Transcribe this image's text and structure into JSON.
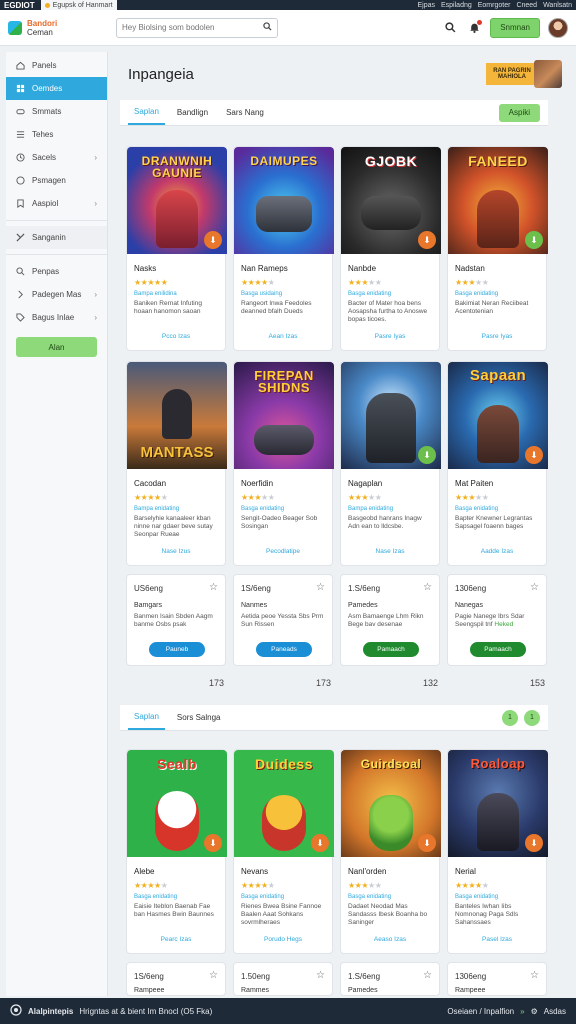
{
  "os_bar": {
    "app": "EGDIOT",
    "tab1": "Egupsk of Hanmart",
    "items": [
      "Ejpas",
      "Espiladng",
      "Eomrgoter",
      "Cneed",
      "Wanlsatn"
    ]
  },
  "header": {
    "logo_line1": "Bandori",
    "logo_line2": "Ceman",
    "search_placeholder": "Hey Biolsing som bodolen",
    "signin_label": "Snmnan"
  },
  "sidebar": {
    "items": [
      {
        "label": "Panels",
        "icon": "home-icon",
        "active": false,
        "chevron": false
      },
      {
        "label": "Oemdes",
        "icon": "grid-icon",
        "active": true,
        "chevron": false
      },
      {
        "label": "Smmats",
        "icon": "gamepad-icon",
        "active": false,
        "chevron": false
      },
      {
        "label": "Tehes",
        "icon": "list-icon",
        "active": false,
        "chevron": false
      },
      {
        "label": "Sacels",
        "icon": "clock-icon",
        "active": false,
        "chevron": true
      },
      {
        "label": "Psmagen",
        "icon": "circle-icon",
        "active": false,
        "chevron": false
      },
      {
        "label": "Aaspiol",
        "icon": "bookmark-icon",
        "active": false,
        "chevron": true
      }
    ],
    "items2": [
      {
        "label": "Sanganin",
        "icon": "tools-icon",
        "chevron": false
      }
    ],
    "items3": [
      {
        "label": "Penpas",
        "icon": "search-icon",
        "chevron": false
      },
      {
        "label": "Padegen Mas",
        "icon": "chevron-right-icon",
        "chevron": true
      },
      {
        "label": "Bagus Inlae",
        "icon": "tag-icon",
        "chevron": true
      }
    ],
    "cta_label": "Alan"
  },
  "main": {
    "title": "Inpangeia",
    "promo_text": "RAN PAGRIN MAHIOLA",
    "tabs1": [
      "Saplan",
      "Bandlign",
      "Sars Nang"
    ],
    "tabs1_action": "Aspiki",
    "row1": [
      {
        "art": "DRANWNIH GAUNIE",
        "name": "Nasks",
        "stars": 5,
        "tag": "Bampa enilidina",
        "desc": "Baniken Rernat Infuting hoaan hanomon saoan",
        "link": "Pcco Izas",
        "corner": "orange"
      },
      {
        "art": "DAIMUPES",
        "name": "Nan Rameps",
        "stars": 4,
        "tag": "Basga usidaing",
        "desc": "Rangeort lnwa Feedoles deanned bfalh Dueds",
        "link": "Aean Izas",
        "corner": "orange"
      },
      {
        "art": "GJOBK",
        "name": "Nanbde",
        "stars": 3,
        "tag": "Basga enidating",
        "desc": "Bacter of Mater hoa bens Aosapsha furtha to Anoswe bopas ticoes.",
        "link": "Pasre Iyas",
        "corner": "orange"
      },
      {
        "art": "FANEED",
        "name": "Nadstan",
        "stars": 3,
        "tag": "Basga enidating",
        "desc": "Bakimiat Neran Reciibeat Acentotenian",
        "link": "Pasre Iyas",
        "corner": "green"
      }
    ],
    "row2": [
      {
        "art": "MANTASS",
        "name": "Cacodan",
        "stars": 4,
        "tag": "Bampa enidating",
        "desc": "Barselyhie kanaaleer kban ninne nar gdaer beve sutay Seonpar Rueae",
        "link": "Nase Izus",
        "corner": ""
      },
      {
        "art": "FIREPAN SHIDNS",
        "name": "Noerfidin",
        "stars": 3,
        "tag": "Basga enidating",
        "desc": "Sengit-Oadeo Beager Sob Sosingan",
        "link": "Pecodlatipe",
        "corner": ""
      },
      {
        "art": "",
        "name": "Nagaplan",
        "stars": 3,
        "tag": "Bampa enidating",
        "desc": "Basgeobd hanrans Inagw Adn ean to lldcsbe.",
        "link": "Nase Izas",
        "corner": "green"
      },
      {
        "art": "Sapaan",
        "name": "Mat Paiten",
        "stars": 3,
        "tag": "Basga enidating",
        "desc": "Bapter Knewner Legrantas Sapsagel foaenn bages",
        "link": "Aadde Izas",
        "corner": "orange"
      }
    ],
    "row3": [
      {
        "price": "US6eng",
        "title": "Bamgars",
        "desc": "Banmen Isain Sbden Aagm banme Osbs psak",
        "hl": "",
        "btn": "Pauneb",
        "btn_color": "blue"
      },
      {
        "price": "1S/6eng",
        "title": "Nanmes",
        "desc": "Aetida peoe Yessta Sbs Prm Sun Rissen",
        "hl": "",
        "btn": "Paneads",
        "btn_color": "blue"
      },
      {
        "price": "1.S/6eng",
        "title": "Pamedes",
        "desc": "Asm Bamaenge Lhm Rikn Bege bav desenae",
        "hl": "",
        "btn": "Pamaach",
        "btn_color": "green"
      },
      {
        "price": "1306eng",
        "title": "Nanegas",
        "desc": "Pagie Nanege Ibrs Sdar Seengspil tnf ",
        "hl": "Heked",
        "btn": "Pamaach",
        "btn_color": "green"
      }
    ],
    "counts": [
      "173",
      "173",
      "132",
      "153"
    ],
    "tabs2": [
      "Saplan",
      "Sors Salnga"
    ],
    "tabs2_buttons": [
      "1",
      "1"
    ],
    "row4": [
      {
        "art": "Sealb",
        "name": "Alebe",
        "stars": 4,
        "tag": "Basga enidating",
        "desc": "Eaisie Iteblon Baenab Fae ban Hasmes Bwin Baunnes",
        "link": "Pearc Izas",
        "corner": "orange"
      },
      {
        "art": "Duidess",
        "name": "Nevans",
        "stars": 4,
        "tag": "Basga enidating",
        "desc": "Rienes Bwea Bsine Fannoe Baalen Aaat Sohkans sovrmlheraes",
        "link": "Porudo Hegs",
        "corner": "orange"
      },
      {
        "art": "Guirdsoal",
        "name": "Nanl'orden",
        "stars": 3,
        "tag": "Basga enidating",
        "desc": "Dadaet Neodad Mas Sandasss Ibesk Boanha bo Saninger",
        "link": "Aeaso Izas",
        "corner": "orange"
      },
      {
        "art": "Roaloap",
        "name": "Nerial",
        "stars": 4,
        "tag": "Basga enidating",
        "desc": "Banteles Iwhan Iibs Nomnonag Paga Sdls Sahanssaes",
        "link": "Pasel Izas",
        "corner": "orange"
      }
    ],
    "row5": [
      {
        "price": "1S/6eng",
        "title": "Rampeee"
      },
      {
        "price": "1.50eng",
        "title": "Rammes"
      },
      {
        "price": "1.S/6eng",
        "title": "Pamedes"
      },
      {
        "price": "1306eng",
        "title": "Rampeee"
      }
    ]
  },
  "bottom_bar": {
    "left": "Alalpintepis",
    "middle": "Hrigntas at & bient Im Bnocl (O5 Fka)",
    "right1": "Oseiaen / Inpalfion",
    "right2": "Asdas"
  }
}
